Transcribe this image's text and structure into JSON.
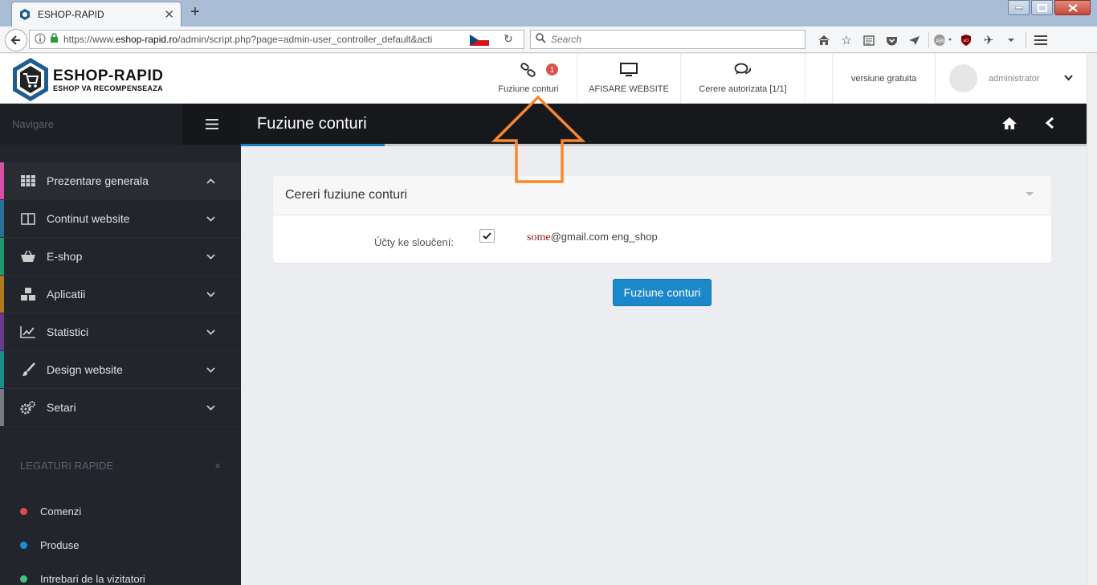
{
  "browser": {
    "tab_title": "ESHOP-RAPID",
    "new_tab": "+",
    "close_tab": "✕",
    "url_prefix": "https://www.",
    "url_domain": "eshop-rapid.ro",
    "url_rest": "/admin/script.php?page=admin-user_controller_default&acti",
    "search_placeholder": "Search"
  },
  "header": {
    "logo_title": "ESHOP-RAPID",
    "logo_subtitle": "ESHOP VA RECOMPENSEAZA",
    "merge_label": "Fuziune conturi",
    "merge_badge": "1",
    "website_label": "AFISARE WEBSITE",
    "requests_label": "Cerere autorizata [1/1]",
    "version_label": "versiune gratuita",
    "user_label": "administrator"
  },
  "sidebar": {
    "nav_label": "Navigare",
    "items": [
      {
        "label": "Prezentare generala",
        "color": "#d84fa8"
      },
      {
        "label": "Continut website",
        "color": "#2a6f96"
      },
      {
        "label": "E-shop",
        "color": "#1e9a70"
      },
      {
        "label": "Aplicatii",
        "color": "#b07a1c"
      },
      {
        "label": "Statistici",
        "color": "#6a3a8c"
      },
      {
        "label": "Design website",
        "color": "#178f8a"
      },
      {
        "label": "Setari",
        "color": "#777b82"
      }
    ],
    "quick_title": "LEGATURI RAPIDE",
    "quick_close": "×",
    "quick_links": [
      {
        "label": "Comenzi",
        "color": "#e04b4b"
      },
      {
        "label": "Produse",
        "color": "#1a8fd8"
      },
      {
        "label": "Intrebari de la vizitatori",
        "color": "#3cc57e"
      }
    ]
  },
  "main": {
    "page_title": "Fuziune conturi",
    "progress_percent": 17,
    "panel_title": "Cereri fuziune conturi",
    "field_label": "Účty ke sloučení:",
    "account_name": "some",
    "account_rest": "@gmail.com eng_shop",
    "account_checked": true,
    "submit_label": "Fuziune conturi"
  },
  "colors": {
    "accent": "#1b88c9",
    "annotation_arrow": "#f7882f"
  }
}
